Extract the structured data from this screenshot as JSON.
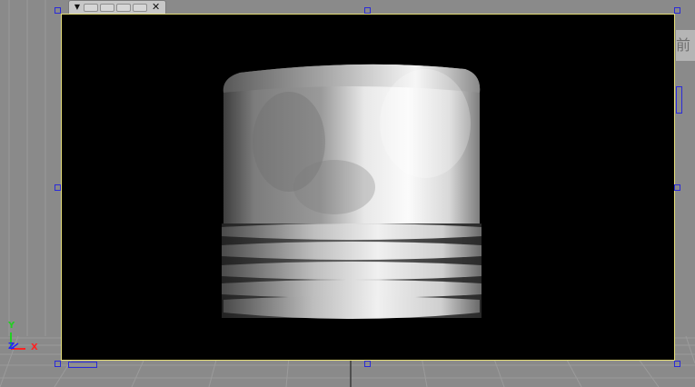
{
  "frame_tab": {
    "menu_arrow": "▼",
    "slot_count": 4,
    "close_glyph": "✕"
  },
  "right_panel": {
    "label": "前"
  },
  "axis_gizmo": {
    "y_label": "Y",
    "z_label": "Z",
    "x_label": "X",
    "y_color": "#22d022",
    "z_color": "#2222ff",
    "x_color": "#ff2222"
  },
  "render": {
    "subject": "piston-model"
  },
  "colors": {
    "viewport_bg": "#8a8a8a",
    "render_bg": "#000000",
    "frame_border": "#e8e07a",
    "handle": "#2a2ad8"
  }
}
